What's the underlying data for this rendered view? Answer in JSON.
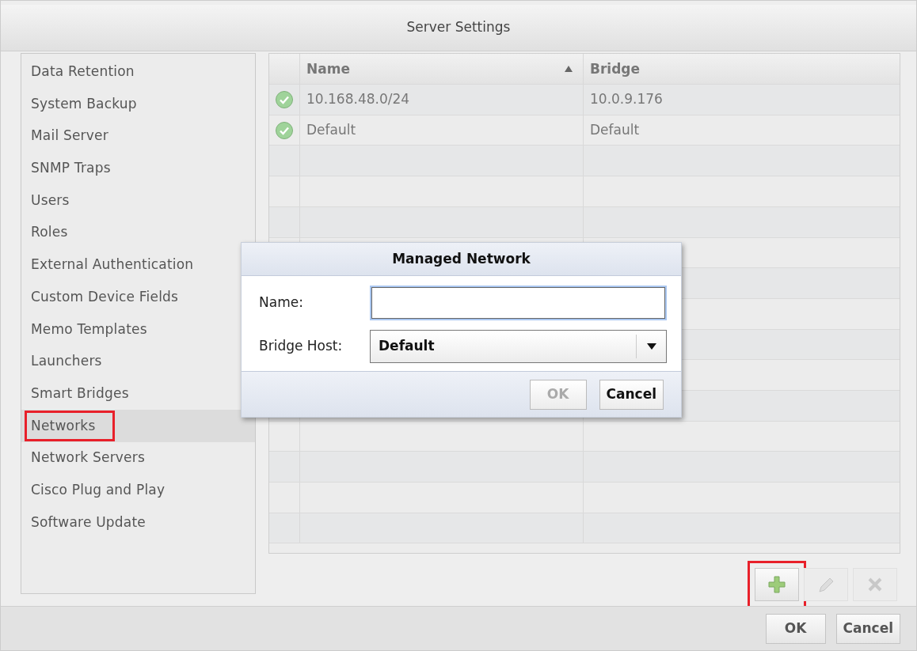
{
  "window": {
    "title": "Server Settings"
  },
  "sidebar": {
    "items": [
      {
        "label": "Data Retention",
        "selected": false,
        "highlighted": false
      },
      {
        "label": "System Backup",
        "selected": false,
        "highlighted": false
      },
      {
        "label": "Mail Server",
        "selected": false,
        "highlighted": false
      },
      {
        "label": "SNMP Traps",
        "selected": false,
        "highlighted": false
      },
      {
        "label": "Users",
        "selected": false,
        "highlighted": false
      },
      {
        "label": "Roles",
        "selected": false,
        "highlighted": false
      },
      {
        "label": "External Authentication",
        "selected": false,
        "highlighted": false
      },
      {
        "label": "Custom Device Fields",
        "selected": false,
        "highlighted": false
      },
      {
        "label": "Memo Templates",
        "selected": false,
        "highlighted": false
      },
      {
        "label": "Launchers",
        "selected": false,
        "highlighted": false
      },
      {
        "label": "Smart Bridges",
        "selected": false,
        "highlighted": false
      },
      {
        "label": "Networks",
        "selected": true,
        "highlighted": true
      },
      {
        "label": "Network Servers",
        "selected": false,
        "highlighted": false
      },
      {
        "label": "Cisco Plug and Play",
        "selected": false,
        "highlighted": false
      },
      {
        "label": "Software Update",
        "selected": false,
        "highlighted": false
      }
    ]
  },
  "table": {
    "columns": [
      {
        "label": "Name",
        "sorted": true
      },
      {
        "label": "Bridge",
        "sorted": false
      }
    ],
    "rows": [
      {
        "ok": true,
        "cells": [
          "10.168.48.0/24",
          "10.0.9.176"
        ]
      },
      {
        "ok": true,
        "cells": [
          "Default",
          "Default"
        ]
      }
    ]
  },
  "toolbar": [
    {
      "kind": "add",
      "disabled": false,
      "highlighted": true
    },
    {
      "kind": "edit",
      "disabled": true,
      "highlighted": false
    },
    {
      "kind": "delete",
      "disabled": true,
      "highlighted": false
    }
  ],
  "buttons": [
    {
      "label": "OK"
    },
    {
      "label": "Cancel"
    }
  ],
  "dialog": {
    "title": "Managed Network",
    "fields": [
      {
        "kind": "text",
        "label": "Name:",
        "focused": true
      },
      {
        "kind": "select",
        "label": "Bridge Host:",
        "value": "Default"
      }
    ],
    "buttons": [
      {
        "label": "OK",
        "disabled": true
      },
      {
        "label": "Cancel",
        "disabled": false
      }
    ]
  }
}
